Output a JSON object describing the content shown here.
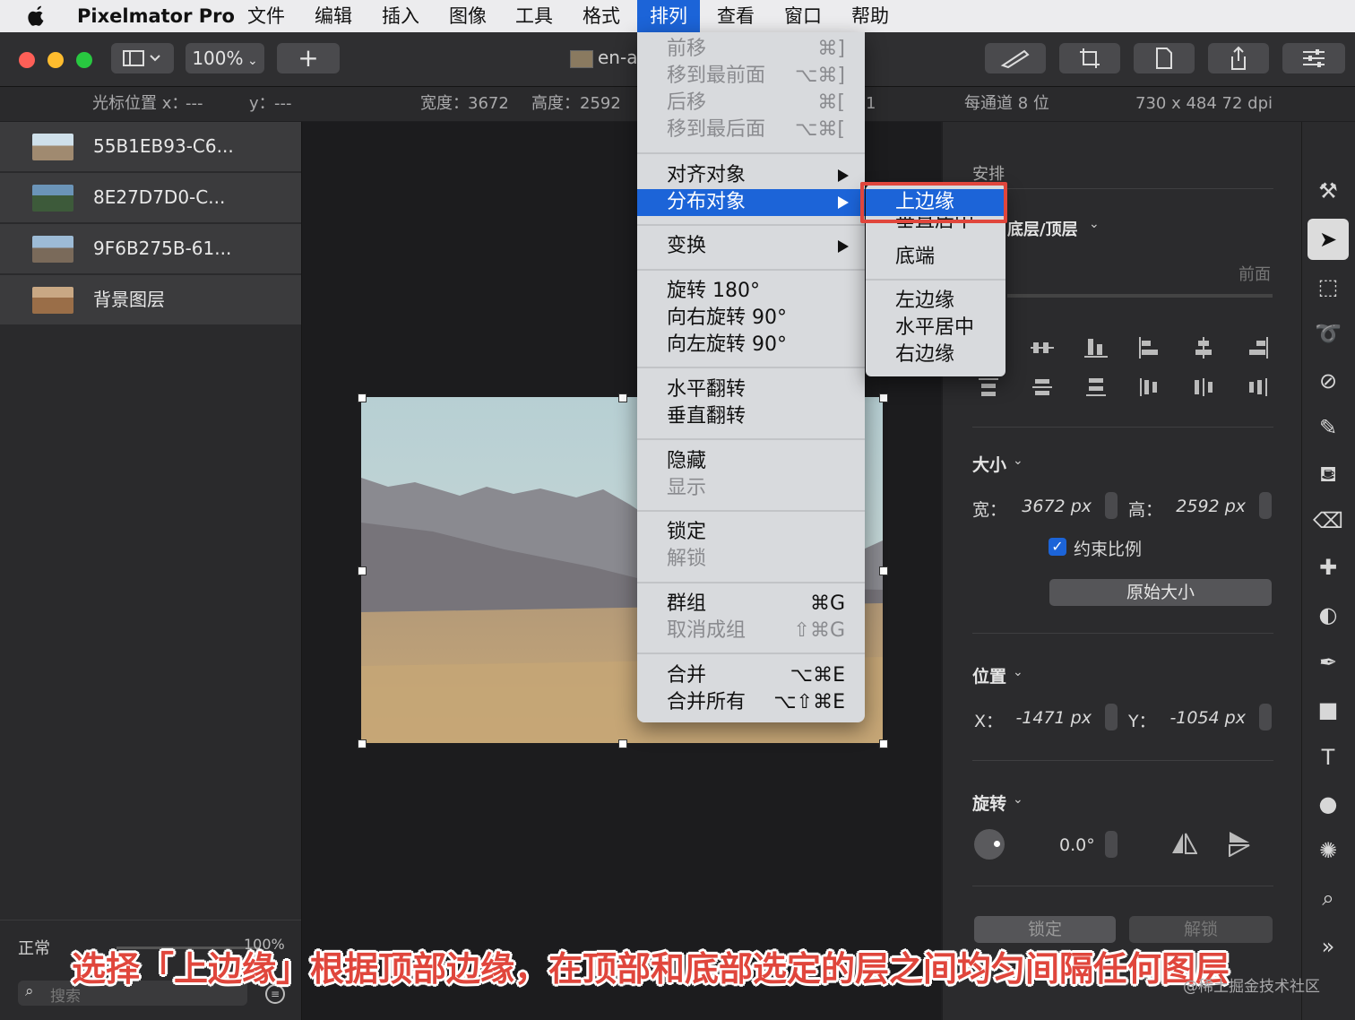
{
  "menubar": {
    "app_name": "Pixelmator Pro",
    "items": [
      "文件",
      "编辑",
      "插入",
      "图像",
      "工具",
      "格式",
      "排列",
      "查看",
      "窗口",
      "帮助"
    ],
    "active_item": "排列"
  },
  "toolbar": {
    "zoom": "100%",
    "add_label": "+",
    "doc_title": "en-a"
  },
  "infobar": {
    "cursor_label": "光标位置 x：",
    "cursor_x": "---",
    "cursor_y_label": "y：",
    "cursor_y": "---",
    "width_label": "宽度：",
    "width_val": "3672",
    "height_label": "高度：",
    "height_val": "2592",
    "partial": "1",
    "depth": "每通道 8 位",
    "resolution": "730 x 484 72 dpi"
  },
  "layers": [
    {
      "name": "55B1EB93-C6..."
    },
    {
      "name": "8E27D7D0-C..."
    },
    {
      "name": "9F6B275B-61..."
    },
    {
      "name": "背景图层"
    }
  ],
  "layers_footer": {
    "blend_mode": "正常",
    "opacity": "100%",
    "search_placeholder": "搜索"
  },
  "arrange_menu": {
    "group1": [
      {
        "label": "前移",
        "shortcut": "⌘]",
        "disabled": true
      },
      {
        "label": "移到最前面",
        "shortcut": "⌥⌘]",
        "disabled": true
      },
      {
        "label": "后移",
        "shortcut": "⌘[",
        "disabled": true
      },
      {
        "label": "移到最后面",
        "shortcut": "⌥⌘[",
        "disabled": true
      }
    ],
    "align": "对齐对象",
    "distribute": "分布对象",
    "transform": "变换",
    "rotate180": "旋转 180°",
    "rotate_right": "向右旋转 90°",
    "rotate_left": "向左旋转 90°",
    "flip_h": "水平翻转",
    "flip_v": "垂直翻转",
    "hide": "隐藏",
    "show": "显示",
    "lock": "锁定",
    "unlock": "解锁",
    "group": "群组",
    "group_sc": "⌘G",
    "ungroup": "取消成组",
    "ungroup_sc": "⇧⌘G",
    "merge": "合并",
    "merge_sc": "⌥⌘E",
    "merge_all": "合并所有",
    "merge_all_sc": "⌥⇧⌘E"
  },
  "distribute_submenu": {
    "top_edge": "上边缘",
    "v_center": "垂直居中",
    "bottom": "底端",
    "left_edge": "左边缘",
    "h_center": "水平居中",
    "right_edge": "右边缘"
  },
  "inspector": {
    "arrange_title": "安排",
    "layer_order": "底层/顶层",
    "front_label": "前面",
    "size_title": "大小",
    "width_label": "宽：",
    "width_val": "3672 px",
    "height_label": "高：",
    "height_val": "2592 px",
    "constrain_label": "约束比例",
    "original_size": "原始大小",
    "position_title": "位置",
    "x_label": "X：",
    "x_val": "-1471 px",
    "y_label": "Y：",
    "y_val": "-1054 px",
    "rotate_title": "旋转",
    "rotate_val": "0.0°",
    "lock_btn": "锁定",
    "unlock_btn": "解锁"
  },
  "caption": "选择「上边缘」根据顶部边缘，在顶部和底部选定的层之间均匀间隔任何图层",
  "watermark": "@稀土掘金技术社区",
  "colors": {
    "accent": "#1c64d8",
    "highlight_box": "#e0463c"
  }
}
